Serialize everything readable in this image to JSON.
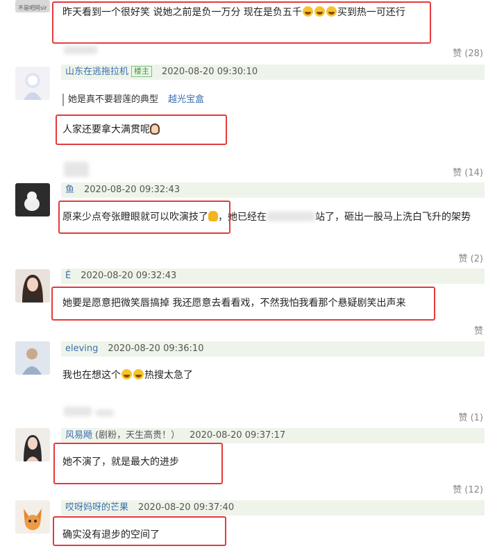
{
  "comments": [
    {
      "avatar_caption": "不是吧阿sir",
      "text": "昨天看到一个很好笑 说她之前是负一万分 现在是负五千",
      "text_after": "买到热一可还行",
      "likes": "赞 (28)"
    },
    {
      "user": "山东在逃拖拉机",
      "tag": "楼主",
      "time": "2020-08-20 09:30:10",
      "quote_text": "她是真不要碧莲的典型",
      "quote_link": "越光宝盒",
      "text": "人家还要拿大满贯呢",
      "likes": "赞 (14)"
    },
    {
      "user": "鱼",
      "time": "2020-08-20 09:32:43",
      "text": "原来少点夸张瞪眼就可以吹演技了",
      "text_tail": "，她已经在",
      "text_tail2": "站了，砸出一股马上洗白飞升的架势",
      "likes": "赞 (2)"
    },
    {
      "user": "É",
      "time": "2020-08-20 09:32:43",
      "text": "她要是愿意把微笑唇搞掉 我还愿意去看看戏，不然我怕我看那个悬疑剧笑出声来",
      "likes": "赞"
    },
    {
      "user": "eleving",
      "time": "2020-08-20 09:36:10",
      "text": "我也在想这个",
      "text_after": "热搜太急了",
      "likes": "赞 (1)"
    },
    {
      "user": "风易飏",
      "user_note": "(剧粉，天生高贵！）",
      "time": "2020-08-20 09:37:17",
      "text": "她不演了，就是最大的进步",
      "likes": "赞 (12)"
    },
    {
      "user": "哎呀妈呀的芒果",
      "time": "2020-08-20 09:37:40",
      "text": "确实没有退步的空间了"
    }
  ],
  "colors": {
    "highlight_box": "#e5393b",
    "username": "#3a6fb0",
    "meta_bg": "#eef4ea"
  }
}
